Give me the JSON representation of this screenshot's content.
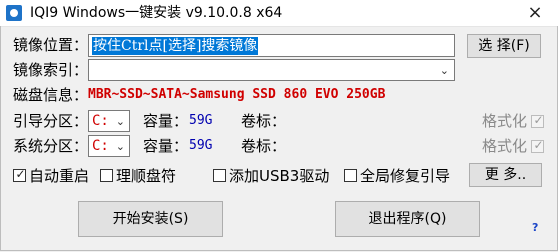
{
  "window": {
    "title": "IQI9 Windows一键安装 v9.10.0.8 x64",
    "close_glyph": "×"
  },
  "image_location": {
    "label": "镜像位置：",
    "value": "按住Ctrl点[选择]搜索镜像",
    "choose_button": "选 择(F)"
  },
  "image_index": {
    "label": "镜像索引：",
    "value": ""
  },
  "disk_info": {
    "label": "磁盘信息：",
    "value": "MBR~SSD~SATA~Samsung SSD 860 EVO 250GB"
  },
  "boot_partition": {
    "label": "引导分区：",
    "drive": "C:",
    "capacity_label": "容量：",
    "capacity": "59G",
    "volume_label": "卷标：",
    "format_label": "格式化",
    "format_checked": true
  },
  "system_partition": {
    "label": "系统分区：",
    "drive": "C:",
    "capacity_label": "容量：",
    "capacity": "59G",
    "volume_label": "卷标：",
    "format_label": "格式化",
    "format_checked": true
  },
  "options": {
    "auto_restart": {
      "label": "自动重启",
      "checked": true
    },
    "fix_drive_letter": {
      "label": "理顺盘符",
      "checked": false
    },
    "add_usb3": {
      "label": "添加USB3驱动",
      "checked": false
    },
    "repair_boot": {
      "label": "全局修复引导",
      "checked": false
    },
    "more_button": "更 多.."
  },
  "actions": {
    "start": "开始安装(S)",
    "exit": "退出程序(Q)",
    "help": "?"
  },
  "colors": {
    "selection_bg": "#0078d7",
    "disk_info": "#d00000",
    "capacity": "#0000b0",
    "help": "#1c46c8"
  }
}
